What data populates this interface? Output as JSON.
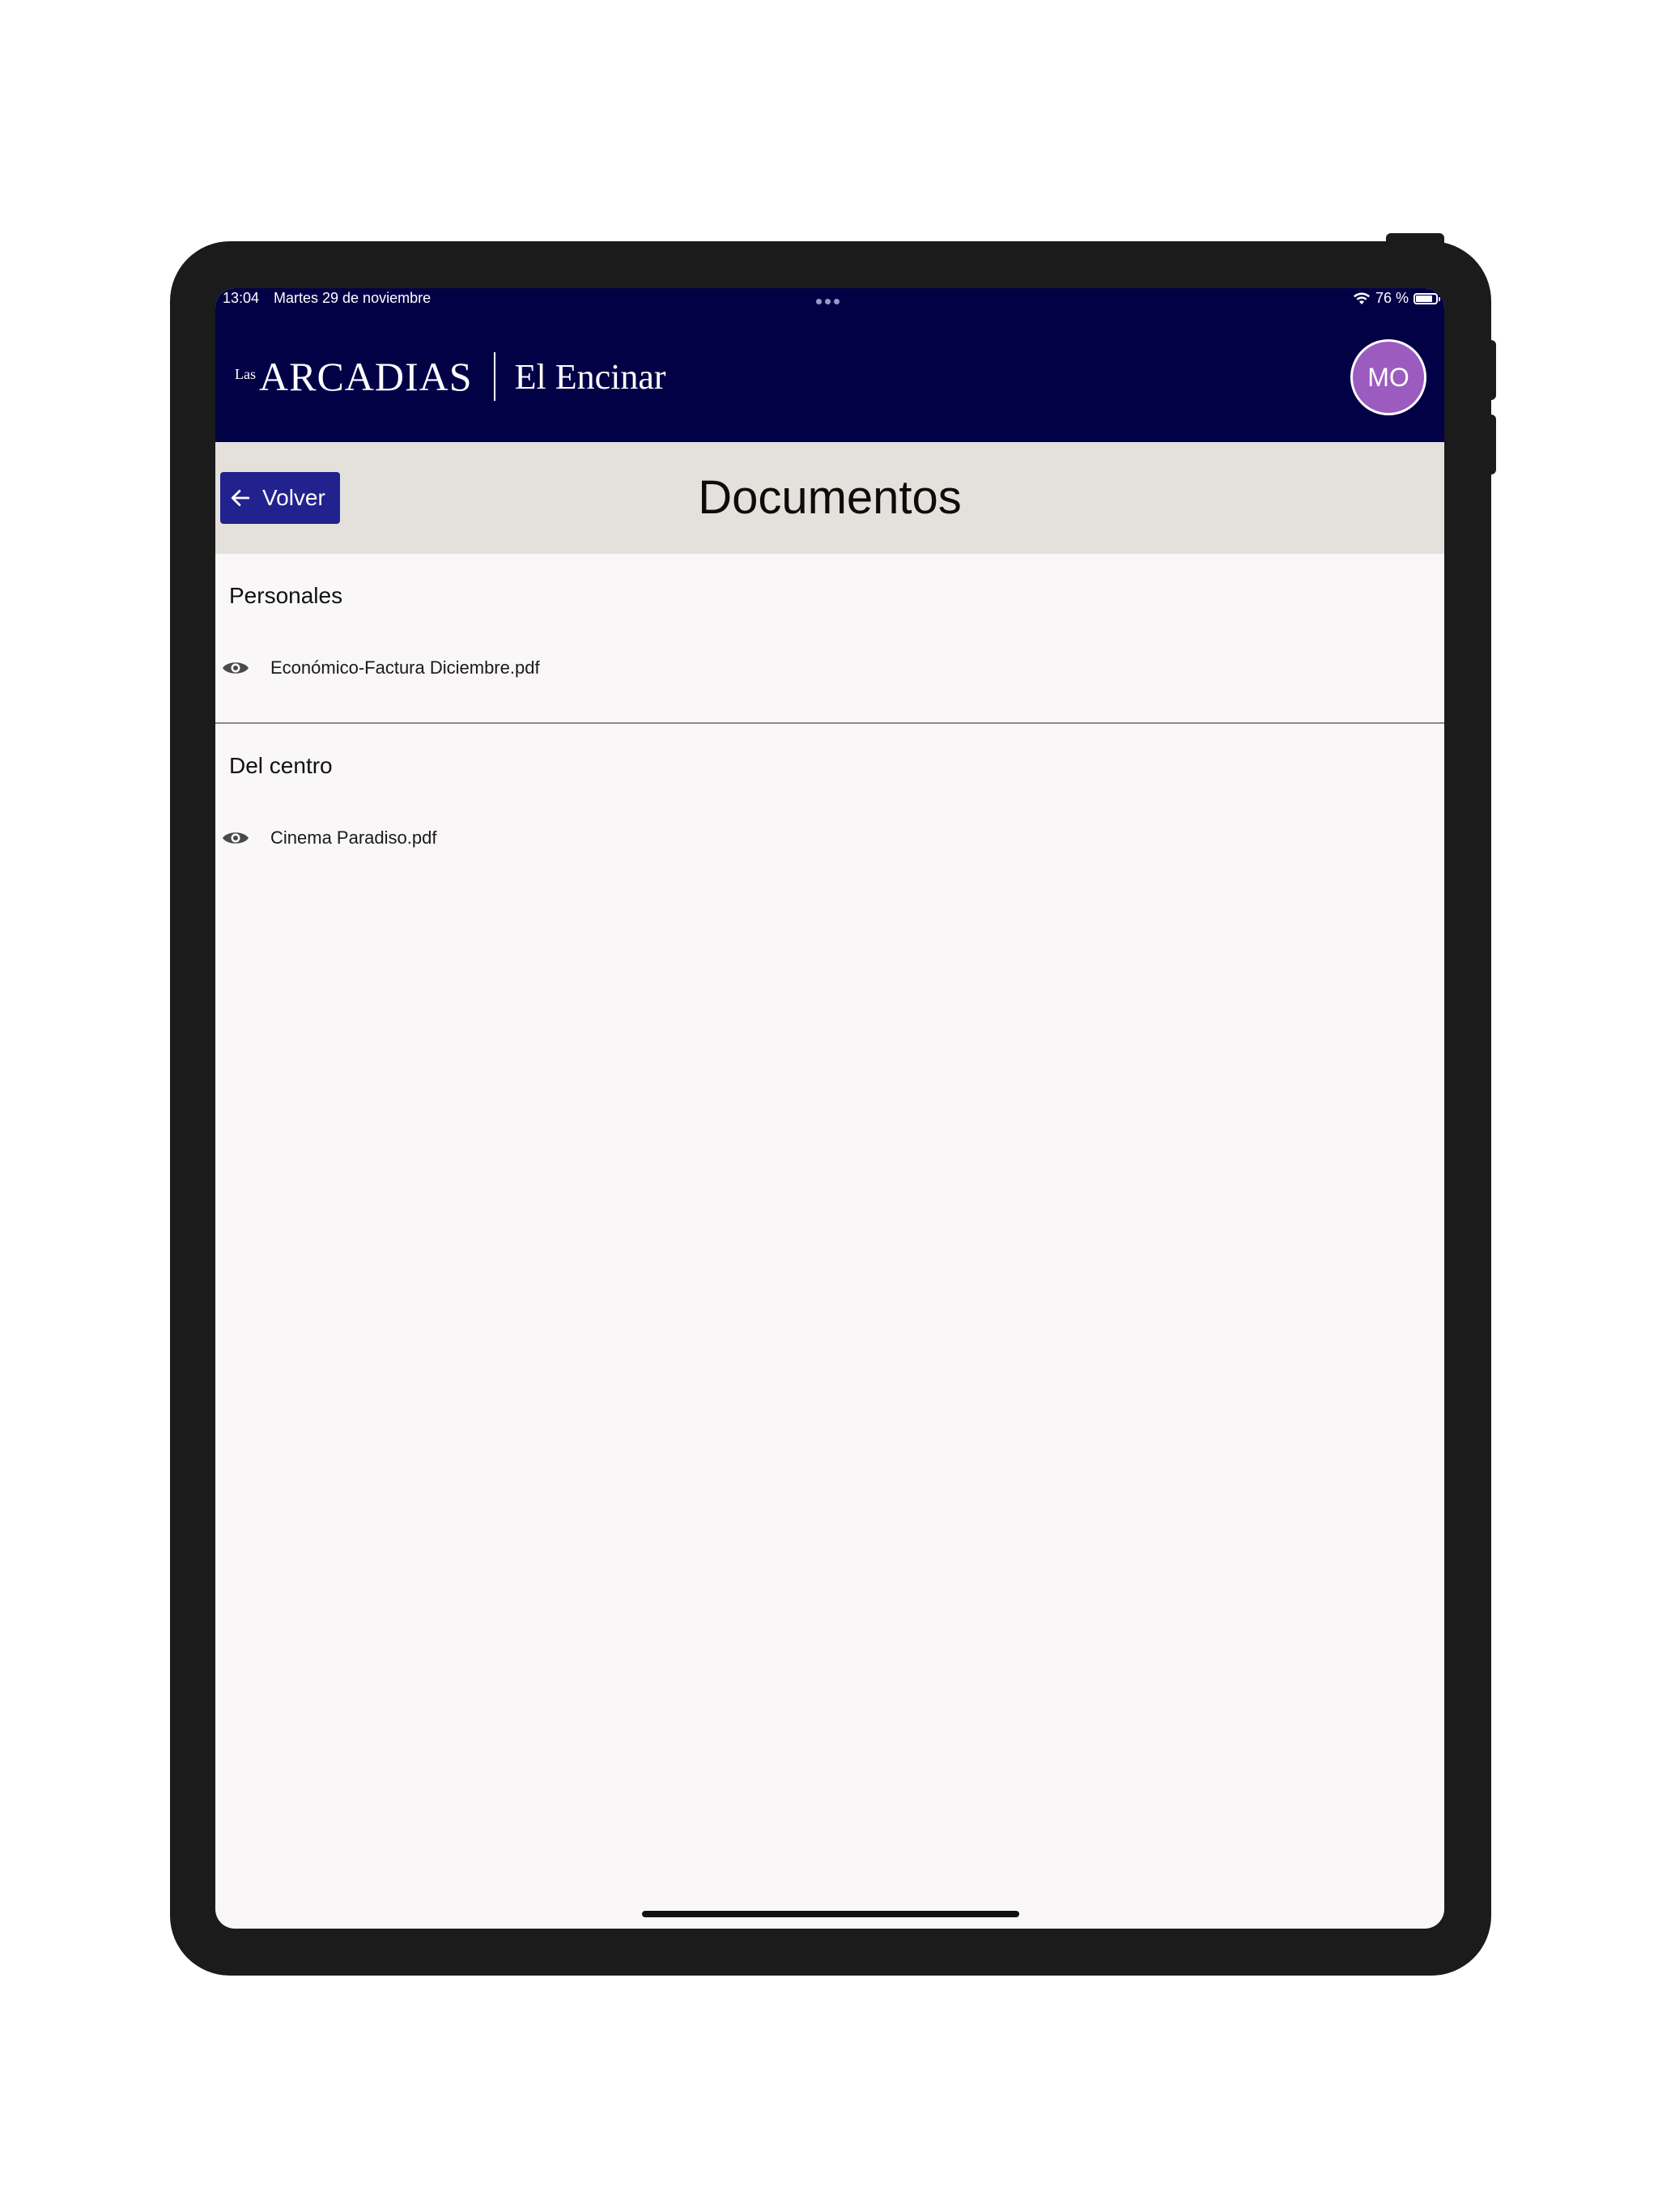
{
  "status_bar": {
    "time": "13:04",
    "date": "Martes 29 de noviembre",
    "battery": "76 %",
    "battery_level": 0.76
  },
  "header": {
    "logo_small": "Las",
    "logo_main": "ARCADIAS",
    "logo_sub": "El Encinar",
    "avatar_initials": "MO",
    "avatar_color": "#9c5bbf",
    "background_color": "#030146"
  },
  "subheader": {
    "back_label": "Volver",
    "title": "Documentos"
  },
  "sections": [
    {
      "title": "Personales",
      "documents": [
        {
          "name": "Económico-Factura Diciembre.pdf",
          "icon": "eye-icon"
        }
      ]
    },
    {
      "title": "Del centro",
      "documents": [
        {
          "name": "Cinema Paradiso.pdf",
          "icon": "eye-icon"
        }
      ]
    }
  ]
}
